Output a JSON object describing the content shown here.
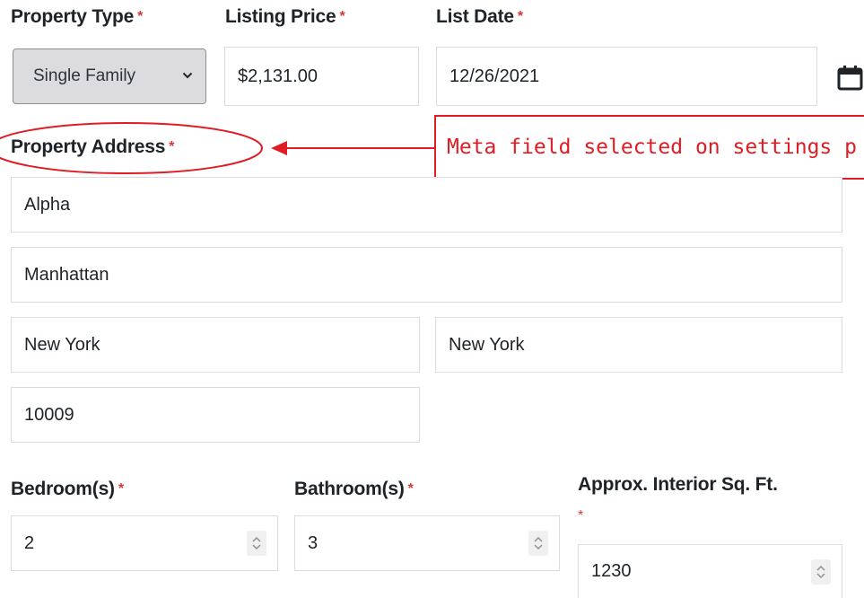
{
  "property_type": {
    "label": "Property Type",
    "required": "*",
    "value": "Single Family"
  },
  "listing_price": {
    "label": "Listing Price",
    "required": "*",
    "value": "$2,131.00"
  },
  "list_date": {
    "label": "List Date",
    "required": "*",
    "value": "12/26/2021"
  },
  "property_address": {
    "label": "Property Address",
    "required": "*",
    "line1": "Alpha",
    "line2": "Manhattan",
    "city": "New York",
    "state": "New York",
    "zip": "10009"
  },
  "annotation": {
    "text": "Meta field selected on settings p",
    "color": "#e01c24"
  },
  "bedrooms": {
    "label": "Bedroom(s)",
    "required": "*",
    "value": "2"
  },
  "bathrooms": {
    "label": "Bathroom(s)",
    "required": "*",
    "value": "3"
  },
  "sqft": {
    "label": "Approx. Interior Sq. Ft.",
    "required": "*",
    "value": "1230"
  },
  "colors": {
    "required": "#d63638",
    "annotation": "#e01c24",
    "select_bg": "#dcdcde"
  },
  "icons": {
    "calendar": "calendar-icon",
    "select": "chevron-down-icon",
    "spinner": "spinner-arrows-icon"
  }
}
